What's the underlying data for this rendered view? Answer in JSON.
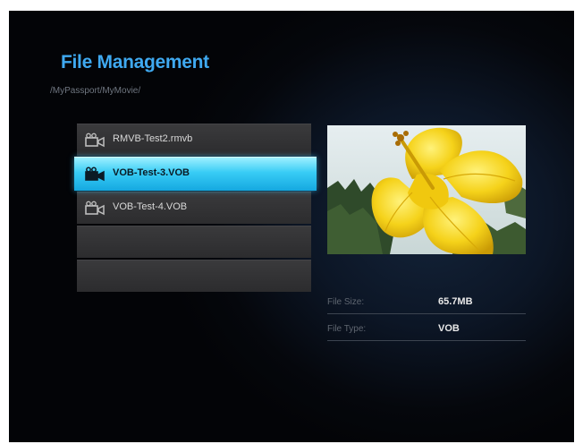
{
  "header": {
    "title": "File Management",
    "path": "/MyPassport/MyMovie/"
  },
  "files": [
    {
      "name": "RMVB-Test2.rmvb",
      "icon": "video-camera-icon",
      "selected": false
    },
    {
      "name": "VOB-Test-3.VOB",
      "icon": "video-camera-icon",
      "selected": true
    },
    {
      "name": "VOB-Test-4.VOB",
      "icon": "video-camera-icon",
      "selected": false
    },
    {
      "name": "",
      "icon": "",
      "selected": false
    },
    {
      "name": "",
      "icon": "",
      "selected": false
    }
  ],
  "details": {
    "size_label": "File Size:",
    "size_value": "65.7MB",
    "type_label": "File Type:",
    "type_value": "VOB"
  },
  "colors": {
    "title": "#3fa9f0",
    "selection": "#38ccf5",
    "flower": "#f5d21a"
  }
}
